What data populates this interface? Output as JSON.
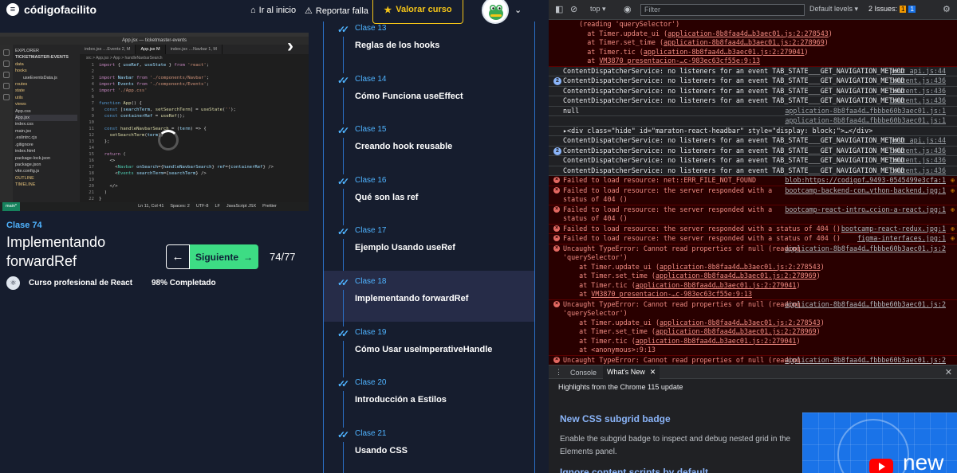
{
  "header": {
    "logo_text": "códigofacilito",
    "nav_home": "Ir al inicio",
    "nav_report": "Reportar falla",
    "rate_button": "Valorar curso"
  },
  "video": {
    "window_title": "App.jsx — ticketmaster-events",
    "explorer_header": "EXPLORER",
    "explorer_project": "TICKETMASTER-EVENTS",
    "explorer_items": [
      "data",
      "hooks",
      "useEventsData.js",
      "routes",
      "state",
      "utils",
      "views",
      "App.css",
      "App.jsx",
      "index.css",
      "main.jsx",
      ".eslintrc.cjs",
      ".gitignore",
      "index.html",
      "package-lock.json",
      "package.json",
      "vite.config.js",
      "OUTLINE",
      "TIMELINE"
    ],
    "tabs": [
      "index.jsx …Events 2, M",
      "App.jsx M",
      "index.jsx …Navbar 1, M"
    ],
    "breadcrumb": "src > App.jsx > App > handleNavbarSearch",
    "status": {
      "branch": "main*",
      "position": "Ln 11, Col 41",
      "spaces": "Spaces: 2",
      "encoding": "UTF-8",
      "eol": "LF",
      "language": "JavaScript JSX",
      "prettier": "Prettier"
    }
  },
  "lesson": {
    "clase_label": "Clase 74",
    "title": "Implementando forwardRef",
    "next_label": "Siguiente",
    "counter": "74/77",
    "course_name": "Curso profesional de React",
    "progress": "98% Completado"
  },
  "classes": [
    {
      "num": "Clase 13",
      "name": "Reglas de los hooks",
      "active": false
    },
    {
      "num": "Clase 14",
      "name": "Cómo Funciona useEffect",
      "active": false
    },
    {
      "num": "Clase 15",
      "name": "Creando hook reusable",
      "active": false
    },
    {
      "num": "Clase 16",
      "name": "Qué son las ref",
      "active": false
    },
    {
      "num": "Clase 17",
      "name": "Ejemplo Usando useRef",
      "active": false
    },
    {
      "num": "Clase 18",
      "name": "Implementando forwardRef",
      "active": true
    },
    {
      "num": "Clase 19",
      "name": "Cómo Usar useImperativeHandle",
      "active": false
    },
    {
      "num": "Clase 20",
      "name": "Introducción a Estilos",
      "active": false
    },
    {
      "num": "Clase 21",
      "name": "Usando CSS",
      "active": false
    }
  ],
  "devtools": {
    "context": "top",
    "filter_placeholder": "Filter",
    "levels": "Default levels",
    "issues_label": "2 Issues:",
    "issues_warn": "1",
    "issues_info": "1"
  },
  "drawer": {
    "tab_console": "Console",
    "tab_whatsnew": "What's New",
    "highlights": "Highlights from the Chrome 115 update",
    "item1_title": "New CSS subgrid badge",
    "item1_desc": "Enable the subgrid badge to inspect and debug nested grid in the Elements panel.",
    "item2_title": "Ignore content scripts by default",
    "promo_text": "new"
  },
  "colors": {
    "accent_blue": "#4fb3ff",
    "next_green": "#3ddc84",
    "rate_yellow": "#f5c518",
    "error_bg": "#290000",
    "error_text": "#f28b82"
  }
}
